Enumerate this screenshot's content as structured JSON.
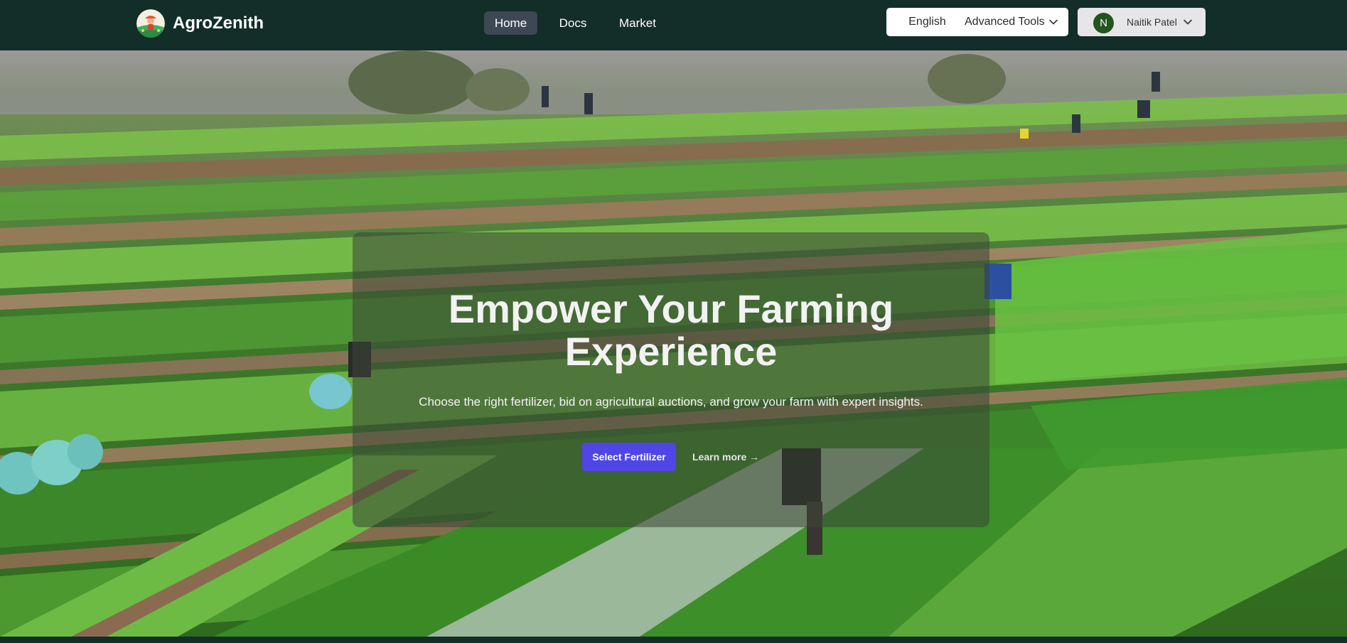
{
  "brand": {
    "name": "AgroZenith",
    "logo_icon": "farmer-logo-icon"
  },
  "nav": {
    "links": [
      {
        "label": "Home",
        "active": true
      },
      {
        "label": "Docs",
        "active": false
      },
      {
        "label": "Market",
        "active": false
      }
    ]
  },
  "header_actions": {
    "language": "English",
    "tools_menu": "Advanced Tools",
    "user": {
      "initial": "N",
      "name": "Naitik Patel"
    }
  },
  "hero": {
    "title_line1": "Empower Your Farming",
    "title_line2": "Experience",
    "subtitle": "Choose the right fertilizer, bid on agricultural auctions, and grow your farm with expert insights.",
    "primary_button": "Select Fertilizer",
    "secondary_link": "Learn more →",
    "background": "farm-field-photo"
  },
  "colors": {
    "navbar_bg": "#132d28",
    "active_nav_bg": "#3d4854",
    "primary_button": "#4f46e5",
    "avatar_bg": "#22551f",
    "user_button_bg": "#e6e6e8"
  }
}
